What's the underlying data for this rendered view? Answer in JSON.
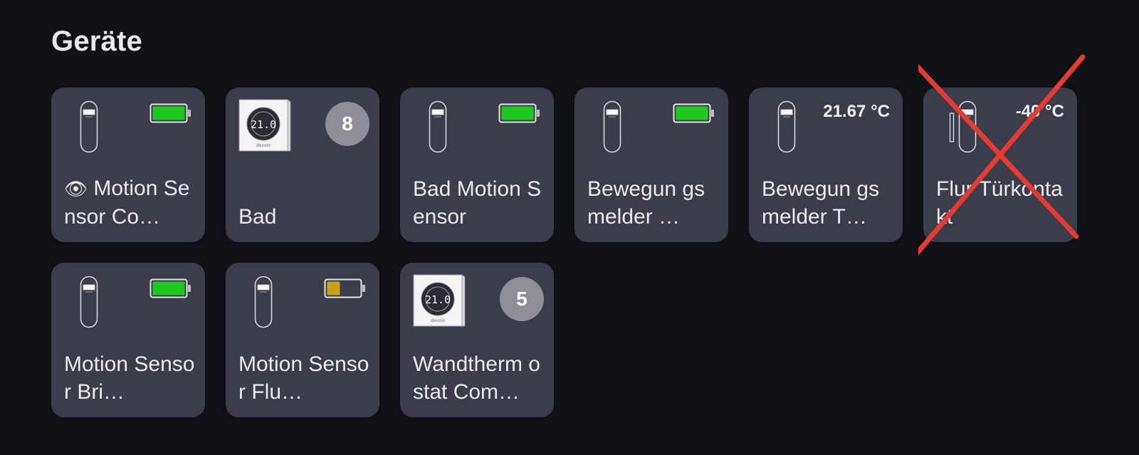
{
  "section": {
    "title": "Geräte"
  },
  "colors": {
    "background": "#101116",
    "tile": "#3c3d4b",
    "battery_full": "#1ec81e",
    "battery_low": "#c9a21a",
    "badge": "#8d8e97",
    "cross": "#e43b35"
  },
  "tiles": [
    {
      "icon": "motion-sensor-icon",
      "prefix": "👁",
      "name": "Motion Sensor Co…",
      "indicator": "battery",
      "battery_level": 1.0
    },
    {
      "icon": "thermostat-icon",
      "thermostat_reading": "21.0",
      "name": "Bad",
      "indicator": "badge",
      "badge": "8"
    },
    {
      "icon": "motion-sensor-icon",
      "name": "Bad Motion Sensor",
      "indicator": "battery",
      "battery_level": 1.0
    },
    {
      "icon": "motion-sensor-icon",
      "name": "Bewegun gsmelder …",
      "indicator": "battery",
      "battery_level": 1.0
    },
    {
      "icon": "motion-sensor-icon",
      "name": "Bewegun gsmelder T…",
      "indicator": "temperature",
      "temperature": "21.67 °C"
    },
    {
      "icon": "door-contact-icon",
      "name": "Flur Türkontakt",
      "indicator": "temperature",
      "temperature": "-40 °C",
      "crossed_out": true
    },
    {
      "icon": "motion-sensor-icon",
      "name": "Motion Sensor Bri…",
      "indicator": "battery",
      "battery_level": 1.0
    },
    {
      "icon": "motion-sensor-icon",
      "name": "Motion Sensor Flu…",
      "indicator": "battery",
      "battery_level": 0.4
    },
    {
      "icon": "thermostat-icon",
      "thermostat_reading": "21.0",
      "name": "Wandtherm ostat Com…",
      "indicator": "badge",
      "badge": "5"
    }
  ]
}
